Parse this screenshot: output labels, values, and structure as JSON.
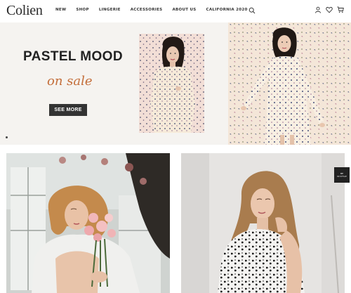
{
  "brand": {
    "logo": "Colien"
  },
  "nav": {
    "items": [
      "NEW",
      "SHOP",
      "LINGERIE",
      "ACCESSORIES",
      "ABOUT US",
      "CALIFORNIA 2020"
    ],
    "icons": [
      "search-icon",
      "user-icon",
      "heart-icon",
      "cart-icon"
    ]
  },
  "hero": {
    "title": "PASTEL MOOD",
    "subtitle": "on sale",
    "cta": "SEE MORE",
    "accent_color": "#c46e3a"
  },
  "badge": {
    "line1": "BE",
    "line2": "IN STYLE"
  }
}
